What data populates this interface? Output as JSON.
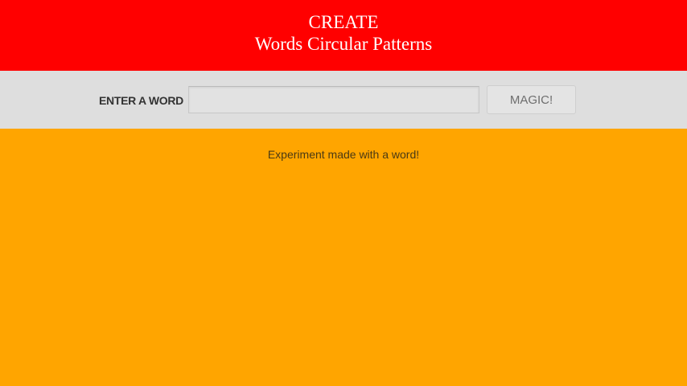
{
  "header": {
    "line1": "CREATE",
    "line2": "Words Circular Patterns"
  },
  "toolbar": {
    "label": "ENTER A WORD",
    "input_value": "",
    "button_label": "MAGIC!"
  },
  "main": {
    "caption": "Experiment made with a word!"
  },
  "colors": {
    "header_bg": "#FF0000",
    "toolbar_bg": "#DEDEDE",
    "canvas_bg": "#FFA500"
  }
}
